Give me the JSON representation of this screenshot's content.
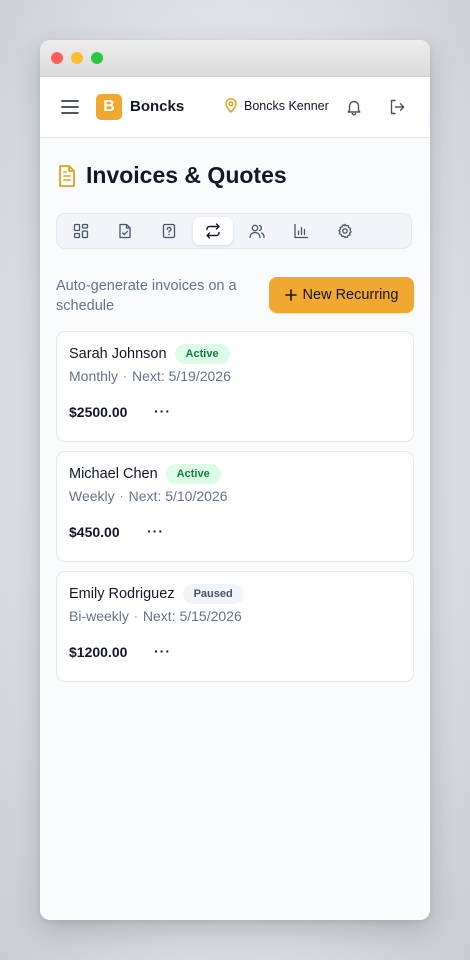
{
  "app": {
    "brand_letter": "B",
    "brand_name": "Boncks",
    "location": "Boncks Kenner",
    "accent_color": "#f0a830"
  },
  "page": {
    "title": "Invoices & Quotes",
    "title_icon": "document-icon"
  },
  "tabs": [
    {
      "name": "dashboard",
      "icon": "grid-icon",
      "active": false
    },
    {
      "name": "invoices",
      "icon": "file-check-icon",
      "active": false
    },
    {
      "name": "quotes",
      "icon": "file-question-icon",
      "active": false
    },
    {
      "name": "recurring",
      "icon": "repeat-icon",
      "active": true
    },
    {
      "name": "clients",
      "icon": "users-icon",
      "active": false
    },
    {
      "name": "reports",
      "icon": "bar-chart-icon",
      "active": false
    },
    {
      "name": "settings",
      "icon": "gear-icon",
      "active": false
    }
  ],
  "recurring": {
    "subtitle": "Auto-generate invoices on a schedule",
    "new_button_label": "New Recurring",
    "items": [
      {
        "name": "Sarah Johnson",
        "status": "Active",
        "frequency": "Monthly",
        "next": "Next: 5/19/2026",
        "amount": "$2500.00",
        "more": "···"
      },
      {
        "name": "Michael Chen",
        "status": "Active",
        "frequency": "Weekly",
        "next": "Next: 5/10/2026",
        "amount": "$450.00",
        "more": "···"
      },
      {
        "name": "Emily Rodriguez",
        "status": "Paused",
        "frequency": "Bi-weekly",
        "next": "Next: 5/15/2026",
        "amount": "$1200.00",
        "more": "···"
      }
    ],
    "separator": "·"
  }
}
